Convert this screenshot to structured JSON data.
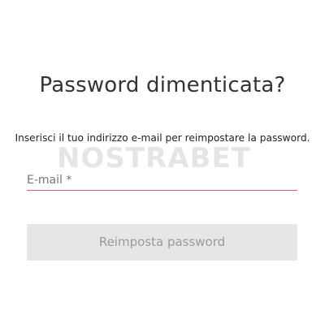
{
  "title": "Password dimenticata?",
  "subtitle": "Inserisci il tuo indirizzo e-mail per reimpostare la password.",
  "watermark": {
    "text": "NOSTRABET"
  },
  "email_field": {
    "placeholder": "E-mail *",
    "value": ""
  },
  "submit_button": {
    "label": "Reimposta password",
    "disabled": true
  },
  "colors": {
    "accent_underline": "#e0558b",
    "button_bg_disabled": "#e6e6e6",
    "button_text_disabled": "#9a9a9a",
    "title_text": "#333333"
  }
}
